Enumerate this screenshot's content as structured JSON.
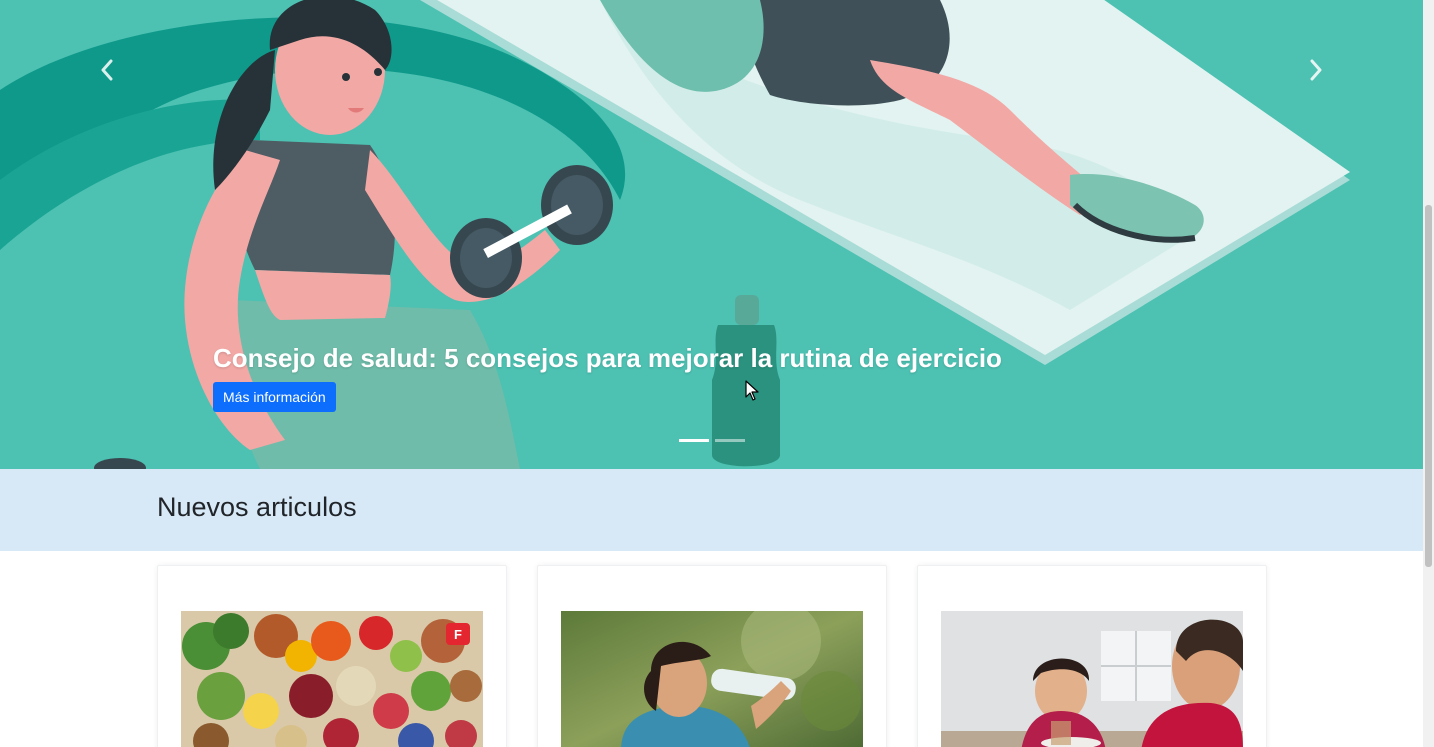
{
  "hero": {
    "title": "Consejo de salud: 5 consejos para mejorar la rutina de ejercicio",
    "button_label": "Más información",
    "slides_count": 2,
    "active_slide": 1,
    "background_color": "#4dc1b2",
    "button_color": "#0d6efd"
  },
  "new_articles": {
    "heading": "Nuevos articulos",
    "band_color": "#d7e9f7"
  },
  "articles": [
    {
      "image": "healthy-food-photo",
      "badge": "F"
    },
    {
      "image": "woman-drinking-water-photo"
    },
    {
      "image": "children-eating-photo"
    }
  ],
  "icons": {
    "prev": "chevron-left-icon",
    "next": "chevron-right-icon"
  }
}
